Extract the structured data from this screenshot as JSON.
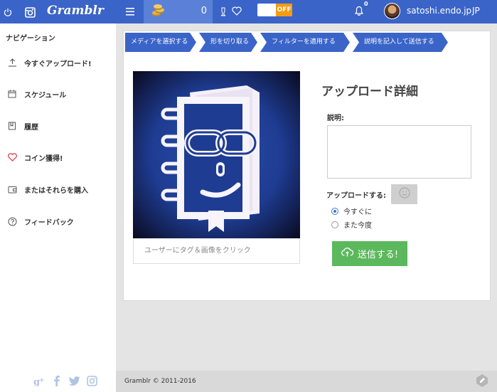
{
  "brand": "Gramblr",
  "coins": {
    "count": "0"
  },
  "toggle": {
    "label": "OFF"
  },
  "notifications": {
    "count": "0"
  },
  "user": {
    "name": "satoshi.endo.jp"
  },
  "language": "JP",
  "sidebar": {
    "heading": "ナビゲーション",
    "items": [
      {
        "label": "今すぐアップロード!",
        "icon": "upload-icon"
      },
      {
        "label": "スケジュール",
        "icon": "calendar-icon"
      },
      {
        "label": "履歴",
        "icon": "bookmark-icon"
      },
      {
        "label": "コイン獲得!",
        "icon": "heart-icon"
      },
      {
        "label": "またはそれらを購入",
        "icon": "wallet-icon"
      },
      {
        "label": "フィードバック",
        "icon": "help-icon"
      }
    ],
    "social": [
      {
        "label": "g+",
        "icon": "google-plus-icon"
      },
      {
        "label": "f",
        "icon": "facebook-icon"
      },
      {
        "label": "t",
        "icon": "twitter-icon"
      },
      {
        "label": "ig",
        "icon": "instagram-icon"
      }
    ]
  },
  "steps": [
    "メディアを選択する",
    "形を切り取る",
    "フィルターを適用する",
    "説明を記入して送信する"
  ],
  "preview": {
    "tag_hint": "ユーザーにタグ＆画像をクリック"
  },
  "upload": {
    "title": "アップロード詳細",
    "description_label": "説明:",
    "description_value": "",
    "when_label": "アップロードする:",
    "options": [
      {
        "label": "今すぐに",
        "selected": true
      },
      {
        "label": "また今度",
        "selected": false
      }
    ],
    "submit_label": "送信する!"
  },
  "footer": {
    "copyright": "Gramblr © 2011-2016"
  },
  "colors": {
    "topbar": "#3a64c8",
    "accent": "#3a64c8",
    "submit": "#5cb85c",
    "toggle_off": "#f39c12"
  }
}
